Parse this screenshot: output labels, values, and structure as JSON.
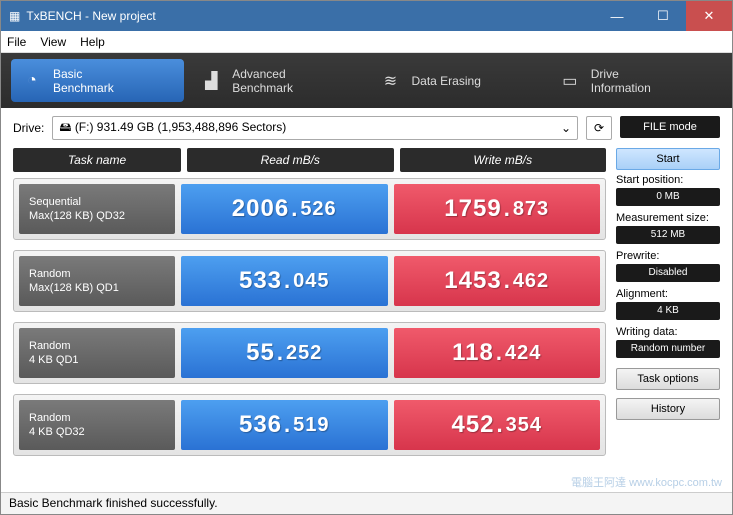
{
  "window": {
    "title": "TxBENCH - New project"
  },
  "menus": {
    "file": "File",
    "view": "View",
    "help": "Help"
  },
  "tabs": {
    "basic": "Basic\nBenchmark",
    "advanced": "Advanced\nBenchmark",
    "erase": "Data Erasing",
    "drive": "Drive\nInformation"
  },
  "drive": {
    "label": "Drive:",
    "selected": "(F:)  931.49 GB (1,953,488,896 Sectors)",
    "filemode": "FILE mode"
  },
  "headers": {
    "task": "Task name",
    "read": "Read mB/s",
    "write": "Write mB/s"
  },
  "rows": [
    {
      "t1": "Sequential",
      "t2": "Max(128 KB) QD32",
      "ri": "2006",
      "rd": "526",
      "wi": "1759",
      "wd": "873"
    },
    {
      "t1": "Random",
      "t2": "Max(128 KB) QD1",
      "ri": "533",
      "rd": "045",
      "wi": "1453",
      "wd": "462"
    },
    {
      "t1": "Random",
      "t2": "4 KB QD1",
      "ri": "55",
      "rd": "252",
      "wi": "118",
      "wd": "424"
    },
    {
      "t1": "Random",
      "t2": "4 KB QD32",
      "ri": "536",
      "rd": "519",
      "wi": "452",
      "wd": "354"
    }
  ],
  "side": {
    "start": "Start",
    "startpos_l": "Start position:",
    "startpos_v": "0 MB",
    "msize_l": "Measurement size:",
    "msize_v": "512 MB",
    "prewrite_l": "Prewrite:",
    "prewrite_v": "Disabled",
    "align_l": "Alignment:",
    "align_v": "4 KB",
    "wdata_l": "Writing data:",
    "wdata_v": "Random number",
    "taskopt": "Task options",
    "history": "History"
  },
  "status": "Basic Benchmark finished successfully.",
  "watermark": "電腦王阿達 www.kocpc.com.tw"
}
